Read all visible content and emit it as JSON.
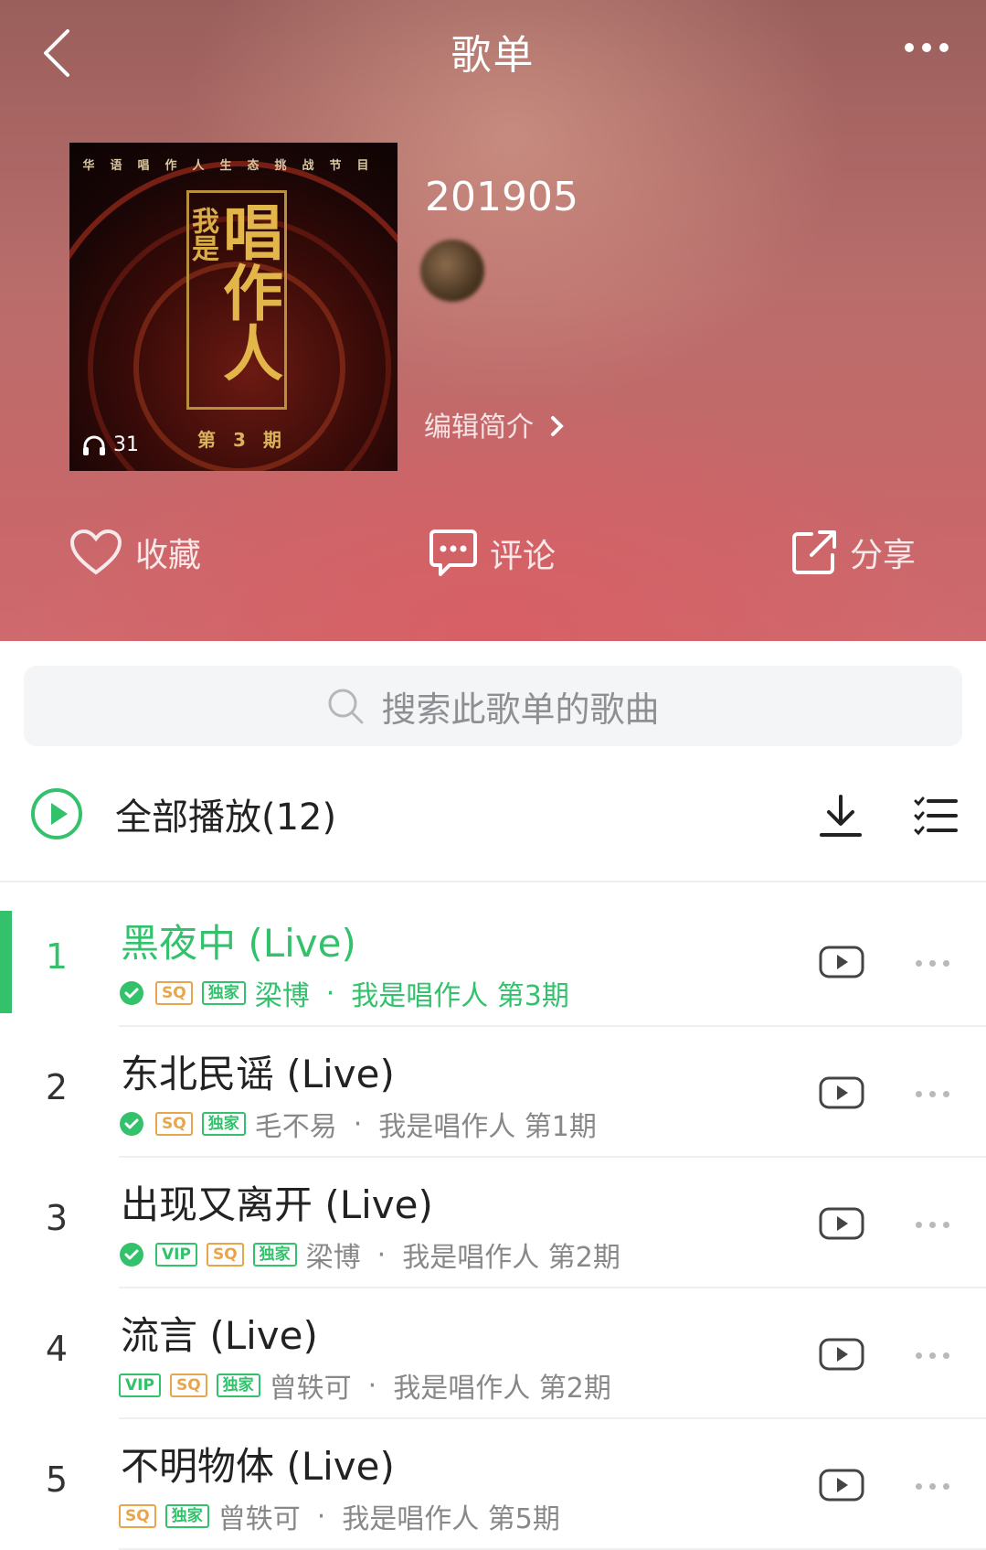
{
  "nav": {
    "title": "歌单"
  },
  "playlist": {
    "title": "201905",
    "creator": "",
    "edit_intro": "编辑简介",
    "play_count": "31",
    "cover": {
      "top_text": "华语唱作人生态挑战节目",
      "main_text": "唱作人",
      "side_text": "我是",
      "issue": "第 3 期"
    }
  },
  "actions": {
    "favorite": "收藏",
    "comment": "评论",
    "share": "分享"
  },
  "search": {
    "placeholder": "搜索此歌单的歌曲"
  },
  "play_all": {
    "label": "全部播放(12)"
  },
  "colors": {
    "accent": "#33c16c",
    "sq_badge": "#e8a54b"
  },
  "songs": [
    {
      "num": "1",
      "title": "黑夜中 (Live)",
      "badges": [
        "SQ",
        "独家"
      ],
      "downloaded": true,
      "artist": "梁博",
      "album": "我是唱作人 第3期",
      "active": true
    },
    {
      "num": "2",
      "title": "东北民谣 (Live)",
      "badges": [
        "SQ",
        "独家"
      ],
      "downloaded": true,
      "artist": "毛不易",
      "album": "我是唱作人 第1期",
      "active": false
    },
    {
      "num": "3",
      "title": "出现又离开 (Live)",
      "badges": [
        "VIP",
        "SQ",
        "独家"
      ],
      "downloaded": true,
      "artist": "梁博",
      "album": "我是唱作人 第2期",
      "active": false
    },
    {
      "num": "4",
      "title": "流言 (Live)",
      "badges": [
        "VIP",
        "SQ",
        "独家"
      ],
      "downloaded": false,
      "artist": "曾轶可",
      "album": "我是唱作人 第2期",
      "active": false
    },
    {
      "num": "5",
      "title": "不明物体 (Live)",
      "badges": [
        "SQ",
        "独家"
      ],
      "downloaded": false,
      "artist": "曾轶可",
      "album": "我是唱作人 第5期",
      "active": false
    }
  ]
}
